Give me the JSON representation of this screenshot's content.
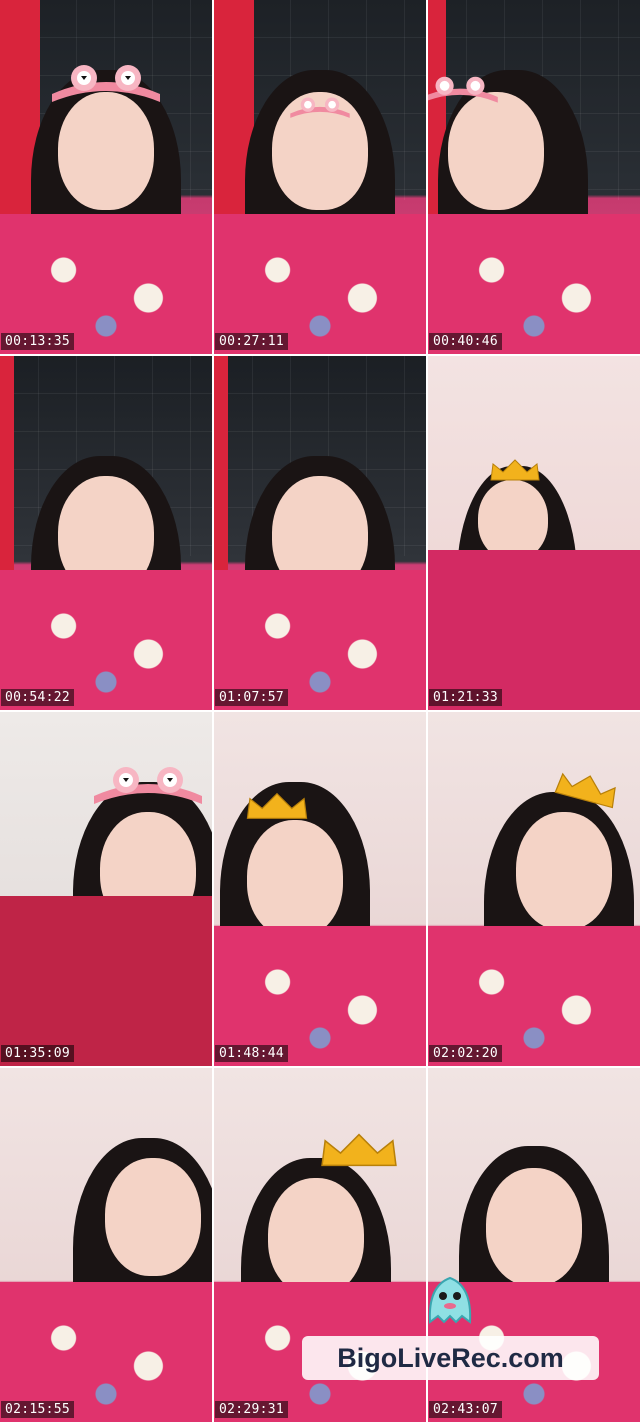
{
  "frames": [
    {
      "timestamp": "00:13:35",
      "scene": "dark",
      "overlay": "headband"
    },
    {
      "timestamp": "00:27:11",
      "scene": "dark",
      "overlay": "headband"
    },
    {
      "timestamp": "00:40:46",
      "scene": "dark",
      "overlay": "headband"
    },
    {
      "timestamp": "00:54:22",
      "scene": "dark2",
      "overlay": "none"
    },
    {
      "timestamp": "01:07:57",
      "scene": "dark2",
      "overlay": "none"
    },
    {
      "timestamp": "01:21:33",
      "scene": "pink",
      "overlay": "crown"
    },
    {
      "timestamp": "01:35:09",
      "scene": "pink",
      "overlay": "headband"
    },
    {
      "timestamp": "01:48:44",
      "scene": "pink2",
      "overlay": "crown"
    },
    {
      "timestamp": "02:02:20",
      "scene": "pink2",
      "overlay": "crown"
    },
    {
      "timestamp": "02:15:55",
      "scene": "pink2",
      "overlay": "none"
    },
    {
      "timestamp": "02:29:31",
      "scene": "pink2",
      "overlay": "crown"
    },
    {
      "timestamp": "02:43:07",
      "scene": "pink2",
      "overlay": "none"
    }
  ],
  "watermark": {
    "text": "BigoLiveRec.com",
    "icon": "ghost-mascot-icon"
  },
  "colors": {
    "headband": "#f08aa0",
    "crown": "#f2b21c",
    "timestamp_bg": "#000000",
    "watermark_text": "#1f2a44"
  }
}
